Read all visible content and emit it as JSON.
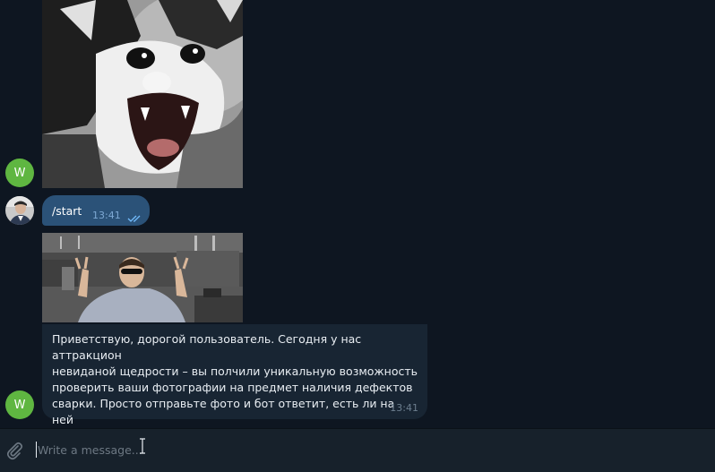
{
  "colors": {
    "background": "#0e1621",
    "bubble_out": "#2b5278",
    "bubble_in": "#182533",
    "composer": "#17212b",
    "avatar_bot": "#5fb641",
    "time_out": "#7da8d3",
    "time_in": "#6d7f8f",
    "read_checks": "#72bcfd"
  },
  "bot": {
    "avatar_letter": "W"
  },
  "messages": {
    "outgoing": {
      "text": "/start",
      "time": "13:41",
      "status": "read"
    },
    "incoming": {
      "text": "Приветствую, дорогой пользователь. Сегодня у нас аттракцион\nневиданой щедрости – вы полчили уникальную возможность\nпроверить ваши фотографии на предмет наличия дефектов\nсварки. Просто отправьте фото и бот ответит, есть ли на ней\nдефекты и подсветит их.",
      "time": "13:41"
    }
  },
  "composer": {
    "placeholder": "Write a message..."
  },
  "icons": {
    "attach": "paperclip-icon",
    "read_status": "double-check-icon",
    "text_cursor": "i-beam-cursor-icon"
  }
}
